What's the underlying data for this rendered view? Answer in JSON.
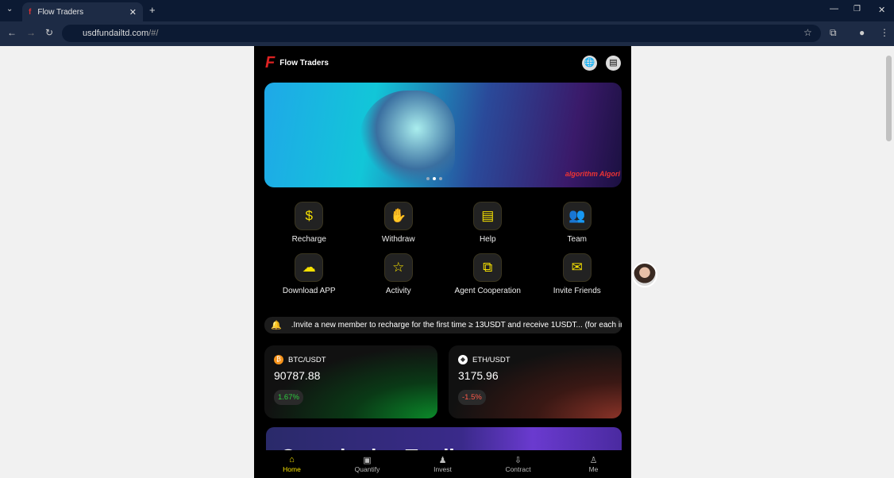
{
  "browser": {
    "tab_title": "Flow Traders",
    "new_tab": "+",
    "url_host": "usdfundailtd.com",
    "url_path": "/#/",
    "window_controls": [
      "—",
      "❐",
      "✕"
    ]
  },
  "header": {
    "brand": "Flow Traders",
    "icons": [
      "globe-icon",
      "chat-icon"
    ]
  },
  "banner": {
    "image_text": "algorithm Algori",
    "slides": 3,
    "active_slide": 1
  },
  "menu": [
    {
      "label": "Recharge",
      "icon": "dollar-refresh-icon",
      "glyph": "$"
    },
    {
      "label": "Withdraw",
      "icon": "coin-hand-icon",
      "glyph": "✋"
    },
    {
      "label": "Help",
      "icon": "book-icon",
      "glyph": "▤"
    },
    {
      "label": "Team",
      "icon": "team-icon",
      "glyph": "👥"
    },
    {
      "label": "Download APP",
      "icon": "cloud-download-icon",
      "glyph": "☁"
    },
    {
      "label": "Activity",
      "icon": "bookmark-star-icon",
      "glyph": "☆"
    },
    {
      "label": "Agent Cooperation",
      "icon": "share-nodes-icon",
      "glyph": "⧉"
    },
    {
      "label": "Invite Friends",
      "icon": "envelope-icon",
      "glyph": "✉"
    }
  ],
  "notice": {
    "text": ".Invite a new member to recharge for the first time ≥ 13USDT and receive 1USDT... (for each invited"
  },
  "markets": [
    {
      "pair": "BTC/USDT",
      "price": "90787.88",
      "change": "1.67%",
      "color": "#2ecc40",
      "coin_color": "#f7931a",
      "coin": "₿"
    },
    {
      "pair": "ETH/USDT",
      "price": "3175.96",
      "change": "-1.5%",
      "color": "#ff5a4a",
      "coin_color": "#ffffff",
      "coin": "◆"
    }
  ],
  "promo": {
    "title": "Quantitative Trading"
  },
  "tabbar": [
    {
      "label": "Home",
      "icon": "home-icon",
      "glyph": "⌂",
      "active": true
    },
    {
      "label": "Quantify",
      "icon": "video-icon",
      "glyph": "▣"
    },
    {
      "label": "Invest",
      "icon": "invest-icon",
      "glyph": "♟"
    },
    {
      "label": "Contract",
      "icon": "contract-icon",
      "glyph": "⇩"
    },
    {
      "label": "Me",
      "icon": "user-icon",
      "glyph": "♙"
    }
  ],
  "colors": {
    "accent": "#f5e000",
    "background": "#000000",
    "up": "#2ecc40",
    "down": "#ff5a4a"
  }
}
